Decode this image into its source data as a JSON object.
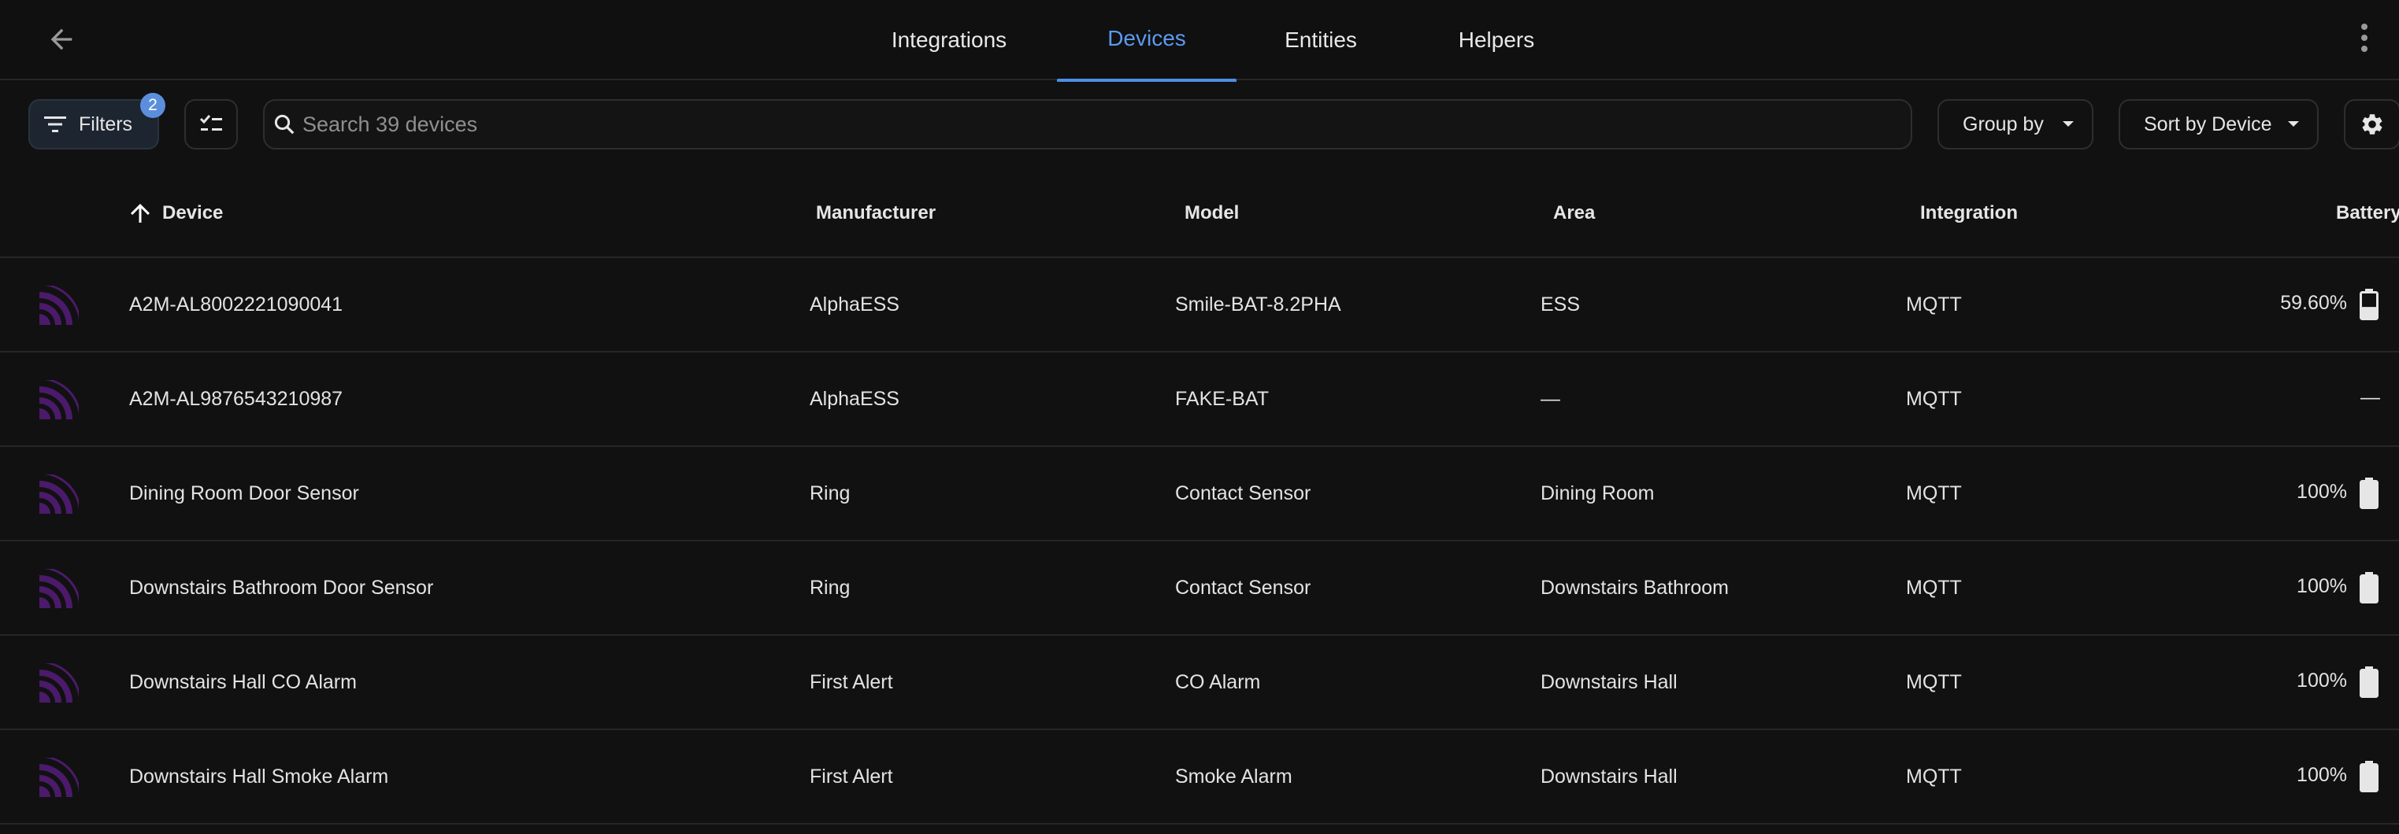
{
  "nav": {
    "back_icon": "arrow-left-icon",
    "tabs": [
      {
        "label": "Integrations"
      },
      {
        "label": "Devices"
      },
      {
        "label": "Entities"
      },
      {
        "label": "Helpers"
      }
    ],
    "active_tab": "Devices",
    "more_icon": "dots-vertical-icon"
  },
  "toolbar": {
    "filters_label": "Filters",
    "filters_count": "2",
    "search_placeholder": "Search 39 devices",
    "search_value": "",
    "group_by_label": "Group by",
    "sort_label": "Sort by Device"
  },
  "table": {
    "columns": {
      "device": "Device",
      "manufacturer": "Manufacturer",
      "model": "Model",
      "area": "Area",
      "integration": "Integration",
      "battery": "Battery"
    },
    "sort_direction_icon": "arrow-up-icon",
    "rows": [
      {
        "device": "A2M-AL8002221090041",
        "manufacturer": "AlphaESS",
        "model": "Smile-BAT-8.2PHA",
        "area": "ESS",
        "integration": "MQTT",
        "battery": "59.60%",
        "battery_level": 0.596
      },
      {
        "device": "A2M-AL9876543210987",
        "manufacturer": "AlphaESS",
        "model": "FAKE-BAT",
        "area": "—",
        "integration": "MQTT",
        "battery": "—",
        "battery_level": null
      },
      {
        "device": "Dining Room Door Sensor",
        "manufacturer": "Ring",
        "model": "Contact Sensor",
        "area": "Dining Room",
        "integration": "MQTT",
        "battery": "100%",
        "battery_level": 1.0
      },
      {
        "device": "Downstairs Bathroom Door Sensor",
        "manufacturer": "Ring",
        "model": "Contact Sensor",
        "area": "Downstairs Bathroom",
        "integration": "MQTT",
        "battery": "100%",
        "battery_level": 1.0
      },
      {
        "device": "Downstairs Hall CO Alarm",
        "manufacturer": "First Alert",
        "model": "CO Alarm",
        "area": "Downstairs Hall",
        "integration": "MQTT",
        "battery": "100%",
        "battery_level": 1.0
      },
      {
        "device": "Downstairs Hall Smoke Alarm",
        "manufacturer": "First Alert",
        "model": "Smoke Alarm",
        "area": "Downstairs Hall",
        "integration": "MQTT",
        "battery": "100%",
        "battery_level": 1.0
      }
    ]
  },
  "colors": {
    "accent": "#5b9af0",
    "mqtt_icon": "#4b1a6b",
    "background": "#111111"
  }
}
